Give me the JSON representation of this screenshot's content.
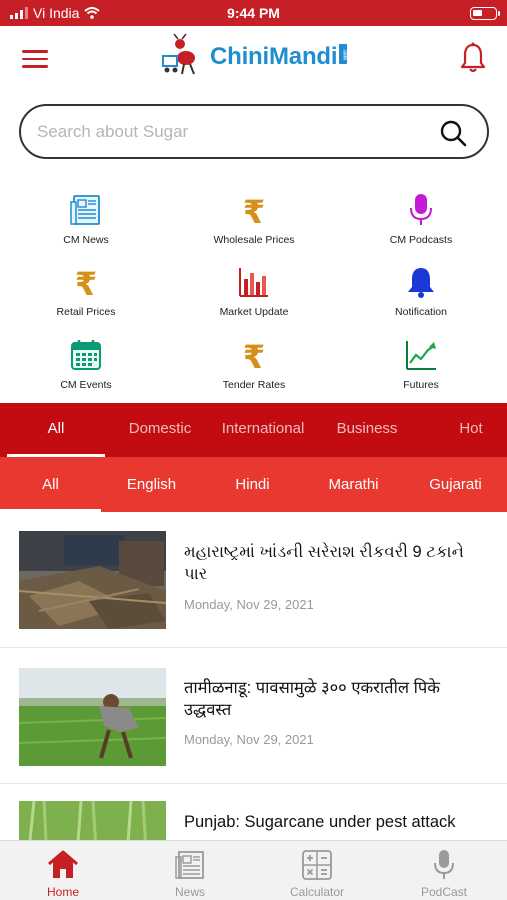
{
  "status_bar": {
    "carrier": "Vi India",
    "time": "9:44 PM"
  },
  "app": {
    "brand_part1": "Chini",
    "brand_part2": "Mandi",
    "brand_suffix": ".com"
  },
  "search": {
    "placeholder": "Search about Sugar"
  },
  "quick_links": [
    {
      "label": "CM News",
      "icon": "newspaper-icon"
    },
    {
      "label": "Wholesale Prices",
      "icon": "rupee-icon"
    },
    {
      "label": "CM Podcasts",
      "icon": "microphone-icon"
    },
    {
      "label": "Retail Prices",
      "icon": "rupee-icon"
    },
    {
      "label": "Market Update",
      "icon": "bar-chart-icon"
    },
    {
      "label": "Notification",
      "icon": "bell-icon"
    },
    {
      "label": "CM Events",
      "icon": "calendar-icon"
    },
    {
      "label": "Tender Rates",
      "icon": "rupee-icon"
    },
    {
      "label": "Futures",
      "icon": "trend-chart-icon"
    }
  ],
  "category_tabs": [
    {
      "label": "All",
      "active": true
    },
    {
      "label": "Domestic",
      "active": false
    },
    {
      "label": "International",
      "active": false
    },
    {
      "label": "Business",
      "active": false
    },
    {
      "label": "Hot",
      "active": false
    }
  ],
  "language_tabs": [
    {
      "label": "All",
      "active": true
    },
    {
      "label": "English",
      "active": false
    },
    {
      "label": "Hindi",
      "active": false
    },
    {
      "label": "Marathi",
      "active": false
    },
    {
      "label": "Gujarati",
      "active": false
    }
  ],
  "news": [
    {
      "title": "મહારાષ્ટ્રમાં ખાંડની સરેરાશ રીકવરી 9 ટકાને પાર",
      "date": "Monday, Nov 29, 2021"
    },
    {
      "title": "तामीळनाडू: पावसामुळे ३०० एकरातील पिके उद्धवस्त",
      "date": "Monday, Nov 29, 2021"
    },
    {
      "title": "Punjab: Sugarcane under pest attack",
      "date": ""
    }
  ],
  "bottom_nav": [
    {
      "label": "Home",
      "active": true
    },
    {
      "label": "News",
      "active": false
    },
    {
      "label": "Calculator",
      "active": false
    },
    {
      "label": "PodCast",
      "active": false
    }
  ],
  "colors": {
    "brand_red": "#c62026",
    "tab_dark_red": "#c20c12",
    "tab_light_red": "#e8382f",
    "brand_blue": "#1f8ed0"
  }
}
